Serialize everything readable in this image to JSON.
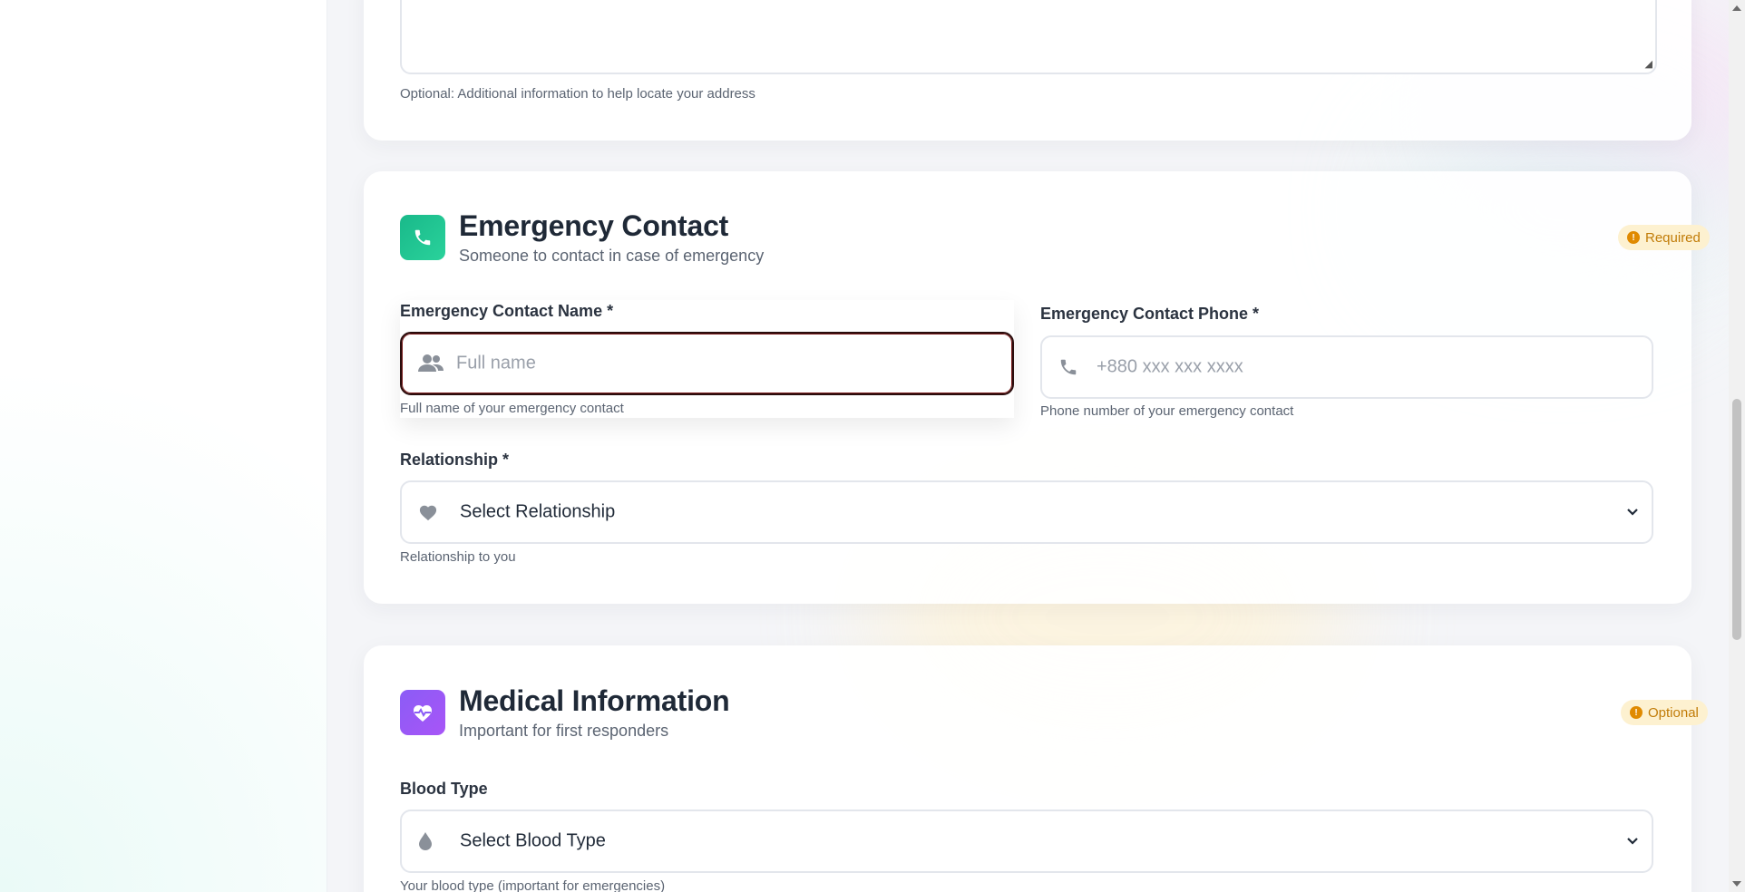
{
  "address_notes": {
    "help": "Optional: Additional information to help locate your address"
  },
  "emergency": {
    "title": "Emergency Contact",
    "subtitle": "Someone to contact in case of emergency",
    "badge": "Required",
    "icon": "phone-icon",
    "name_label": "Emergency Contact Name *",
    "name_placeholder": "Full name",
    "name_help": "Full name of your emergency contact",
    "phone_label": "Emergency Contact Phone *",
    "phone_placeholder": "+880 xxx xxx xxxx",
    "phone_help": "Phone number of your emergency contact",
    "relationship_label": "Relationship *",
    "relationship_value": "Select Relationship",
    "relationship_help": "Relationship to you"
  },
  "medical": {
    "title": "Medical Information",
    "subtitle": "Important for first responders",
    "badge": "Optional",
    "icon": "heart-pulse-icon",
    "blood_label": "Blood Type",
    "blood_value": "Select Blood Type",
    "blood_help": "Your blood type (important for emergencies)"
  },
  "colors": {
    "emergency_accent": "#1fbf8f",
    "medical_accent": "#8b5cf6",
    "badge_bg": "#fdf1d0",
    "badge_text": "#c17c08",
    "focus_border": "#2a0d0d"
  }
}
